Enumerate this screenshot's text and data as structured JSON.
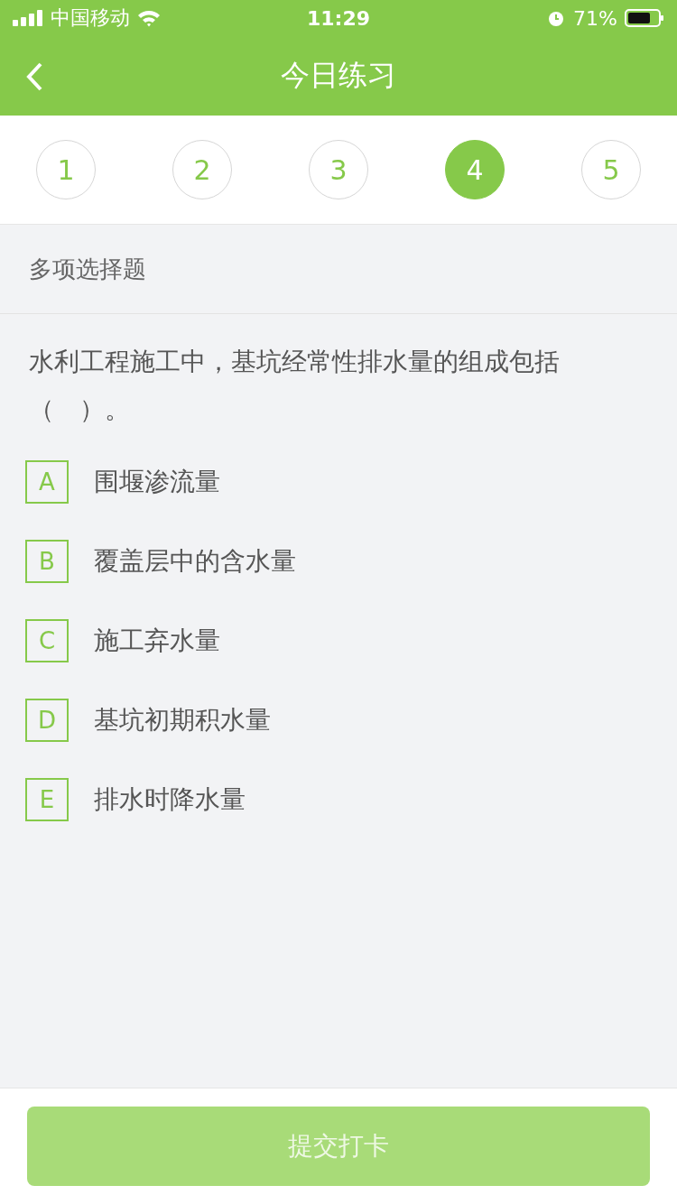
{
  "status_bar": {
    "carrier": "中国移动",
    "time": "11:29",
    "battery": "71%"
  },
  "nav": {
    "title": "今日练习"
  },
  "steps": [
    {
      "label": "1",
      "selected": false
    },
    {
      "label": "2",
      "selected": false
    },
    {
      "label": "3",
      "selected": false
    },
    {
      "label": "4",
      "selected": true
    },
    {
      "label": "5",
      "selected": false
    }
  ],
  "section": {
    "title": "多项选择题"
  },
  "question": {
    "text": "水利工程施工中，基坑经常性排水量的组成包括（　）。"
  },
  "options": [
    {
      "letter": "A",
      "text": "围堰渗流量",
      "selected": false
    },
    {
      "letter": "B",
      "text": "覆盖层中的含水量",
      "selected": false
    },
    {
      "letter": "C",
      "text": "施工弃水量",
      "selected": false
    },
    {
      "letter": "D",
      "text": "基坑初期积水量",
      "selected": false
    },
    {
      "letter": "E",
      "text": "排水时降水量",
      "selected": false
    }
  ],
  "submit": {
    "label": "提交打卡",
    "disabled": true
  }
}
